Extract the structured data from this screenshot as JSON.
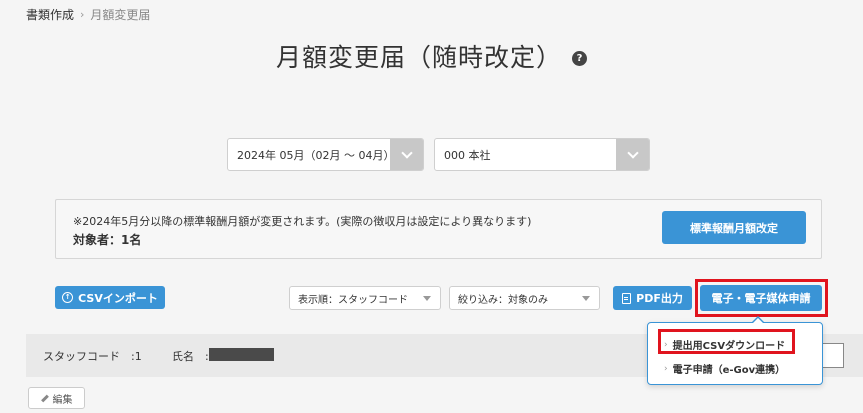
{
  "breadcrumb": {
    "parent": "書類作成",
    "separator": "›",
    "current": "月額変更届"
  },
  "page": {
    "title": "月額変更届（随時改定）",
    "help_icon": "?"
  },
  "filters": {
    "period": "2024年 05月（02月 〜 04月）",
    "office": "000 本社"
  },
  "notice": {
    "message": "※2024年5月分以降の標準報酬月額が変更されます。(実際の徴収月は設定により異なります)",
    "target": "対象者：1名",
    "button": "標準報酬月額改定"
  },
  "toolbar": {
    "csv_import": "CSVインポート",
    "sort": "表示順：スタッフコード",
    "filter": "絞り込み：対象のみ",
    "pdf": "PDF出力",
    "electronic": "電子・電子媒体申請"
  },
  "dropdown": {
    "items": [
      {
        "label": "提出用CSVダウンロード"
      },
      {
        "label": "電子申請（e-Gov連携）"
      }
    ]
  },
  "staff": {
    "code_label": "スタッフコード　:1",
    "name_label": "氏名　:"
  },
  "edit_button": "編集",
  "colors": {
    "accent": "#3a94d6",
    "highlight": "#e0141e"
  }
}
